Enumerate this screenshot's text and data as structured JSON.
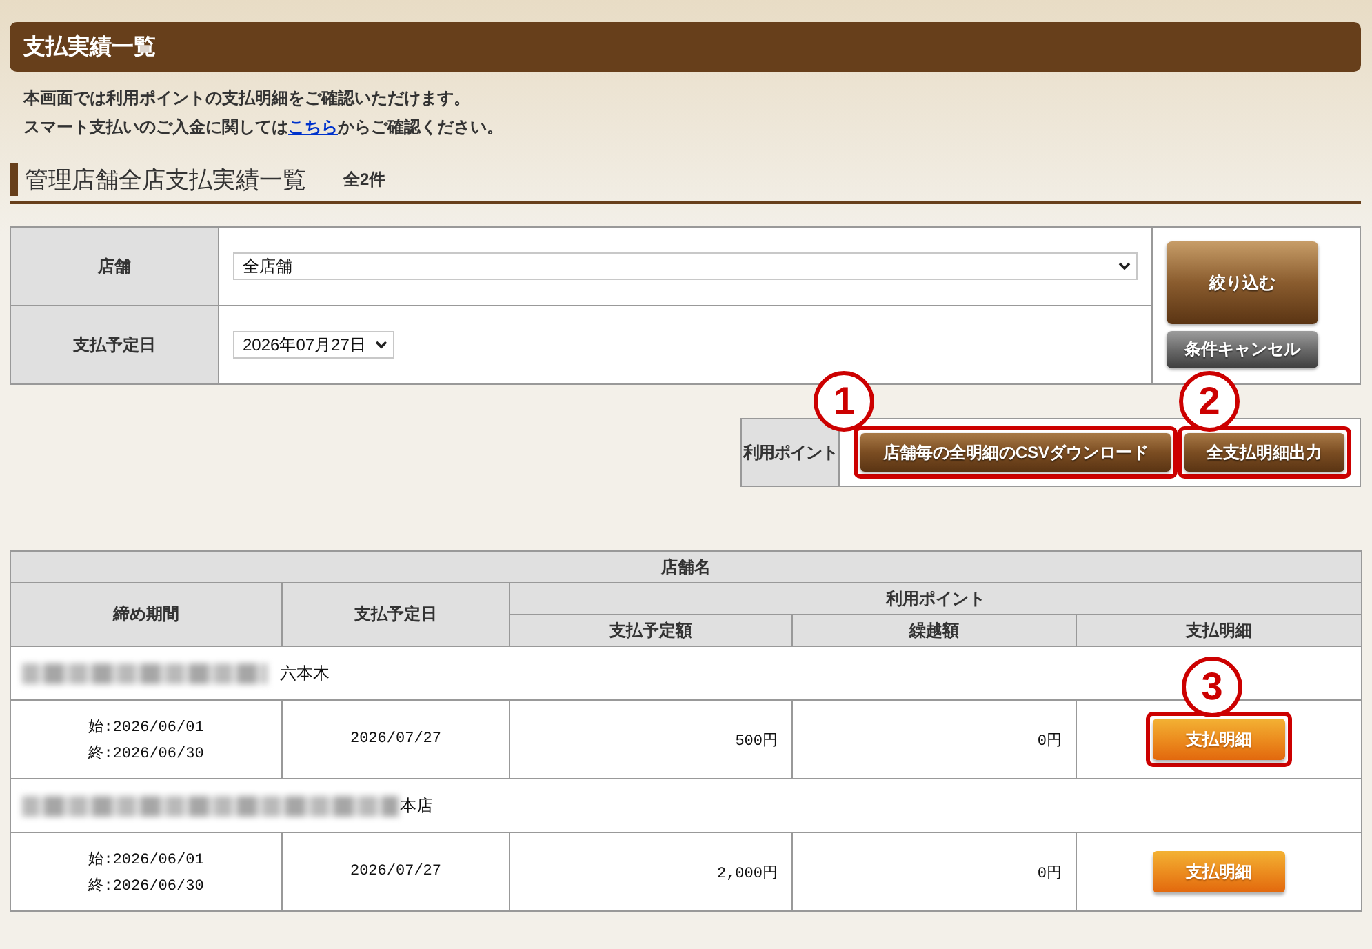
{
  "page_title": "支払実績一覧",
  "notice": {
    "line_1": "本画面では利用ポイントの支払明細をご確認いただけます。",
    "line_2": {
      "before": "スマート支払いのご入金に関しては",
      "link": "こちら",
      "after": "からご確認ください。"
    }
  },
  "section": {
    "title": "管理店舗全店支払実績一覧",
    "count": "全2件"
  },
  "filters": {
    "fields": [
      {
        "label": "店舗",
        "value": "全店舗",
        "kind": "wide"
      },
      {
        "label": "支払予定日",
        "value": "2026年07月27日",
        "kind": "compact"
      }
    ],
    "buttons": [
      {
        "label": "絞り込む",
        "kind": "primary"
      },
      {
        "label": "条件キャンセル",
        "kind": "secondary"
      }
    ]
  },
  "points_export": {
    "label": "利用ポイント",
    "buttons": [
      {
        "label": "店舗毎の全明細のCSVダウンロード",
        "callout": "1"
      },
      {
        "label": "全支払明細出力",
        "callout": "2"
      }
    ]
  },
  "table": {
    "caption_row": "店舗名",
    "columns": [
      {
        "label": "締め期間"
      },
      {
        "label": "支払予定日"
      },
      {
        "label": "利用ポイント",
        "children": [
          {
            "label": "支払予定額"
          },
          {
            "label": "繰越額"
          },
          {
            "label": "支払明細"
          }
        ]
      }
    ],
    "stores": [
      {
        "name": "六本木",
        "redacted": true,
        "period_start": "始:2026/06/01",
        "period_end": "終:2026/06/30",
        "payment_date": "2026/07/27",
        "scheduled_amount": "500円",
        "carryover": "0円",
        "action": "支払明細",
        "callout": "3"
      },
      {
        "name": "本店",
        "redacted": true,
        "period_start": "始:2026/06/01",
        "period_end": "終:2026/06/30",
        "payment_date": "2026/07/27",
        "scheduled_amount": "2,000円",
        "carryover": "0円",
        "action": "支払明細"
      }
    ]
  }
}
